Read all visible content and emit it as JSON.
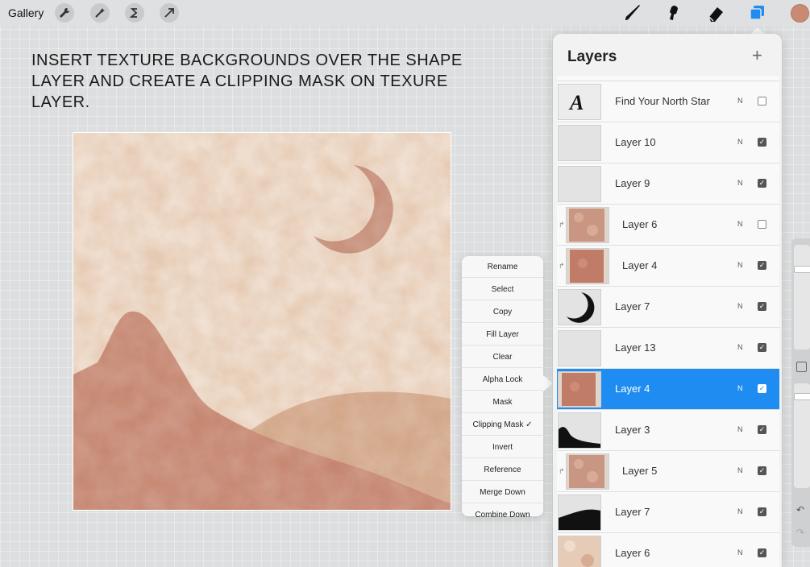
{
  "toolbar": {
    "gallery_label": "Gallery",
    "left_tools": [
      "wrench-icon",
      "magic-wand-icon",
      "selection-icon",
      "transform-arrow-icon"
    ],
    "right_tools": [
      "brush-icon",
      "smudge-icon",
      "eraser-icon",
      "layers-icon"
    ],
    "active_color": "#c98a74",
    "layers_active_color": "#1e8cf0"
  },
  "instruction": {
    "text": "INSERT TEXTURE BACKGROUNDS OVER THE SHAPE LAYER AND CREATE A CLIPPING MASK ON TEXURE LAYER."
  },
  "context_menu": {
    "items": [
      "Rename",
      "Select",
      "Copy",
      "Fill Layer",
      "Clear",
      "Alpha Lock",
      "Mask",
      "Clipping Mask ✓",
      "Invert",
      "Reference",
      "Merge Down",
      "Combine Down"
    ]
  },
  "layers_panel": {
    "title": "Layers",
    "add_label": "+",
    "blend_label": "N",
    "layers": [
      {
        "name": "Find Your North Star",
        "thumb": "text-A",
        "visible": false,
        "clipped": false,
        "selected": false
      },
      {
        "name": "Layer 10",
        "thumb": "blank",
        "visible": true,
        "clipped": false,
        "selected": false
      },
      {
        "name": "Layer 9",
        "thumb": "blank",
        "visible": true,
        "clipped": false,
        "selected": false
      },
      {
        "name": "Layer 6",
        "thumb": "texture",
        "visible": false,
        "clipped": true,
        "selected": false
      },
      {
        "name": "Layer 4",
        "thumb": "texture-solid",
        "visible": true,
        "clipped": true,
        "selected": false
      },
      {
        "name": "Layer 7",
        "thumb": "moon",
        "visible": true,
        "clipped": false,
        "selected": false
      },
      {
        "name": "Layer 13",
        "thumb": "blank",
        "visible": true,
        "clipped": false,
        "selected": false
      },
      {
        "name": "Layer 4",
        "thumb": "texture-solid",
        "visible": true,
        "clipped": false,
        "selected": true
      },
      {
        "name": "Layer 3",
        "thumb": "mountain",
        "visible": true,
        "clipped": false,
        "selected": false
      },
      {
        "name": "Layer 5",
        "thumb": "texture",
        "visible": true,
        "clipped": true,
        "selected": false
      },
      {
        "name": "Layer 7",
        "thumb": "hills",
        "visible": true,
        "clipped": false,
        "selected": false
      },
      {
        "name": "Layer 6",
        "thumb": "texture-light",
        "visible": true,
        "clipped": false,
        "selected": false
      }
    ]
  },
  "sidebar": {
    "undo_icon": "undo-icon",
    "redo_icon": "redo-icon"
  }
}
